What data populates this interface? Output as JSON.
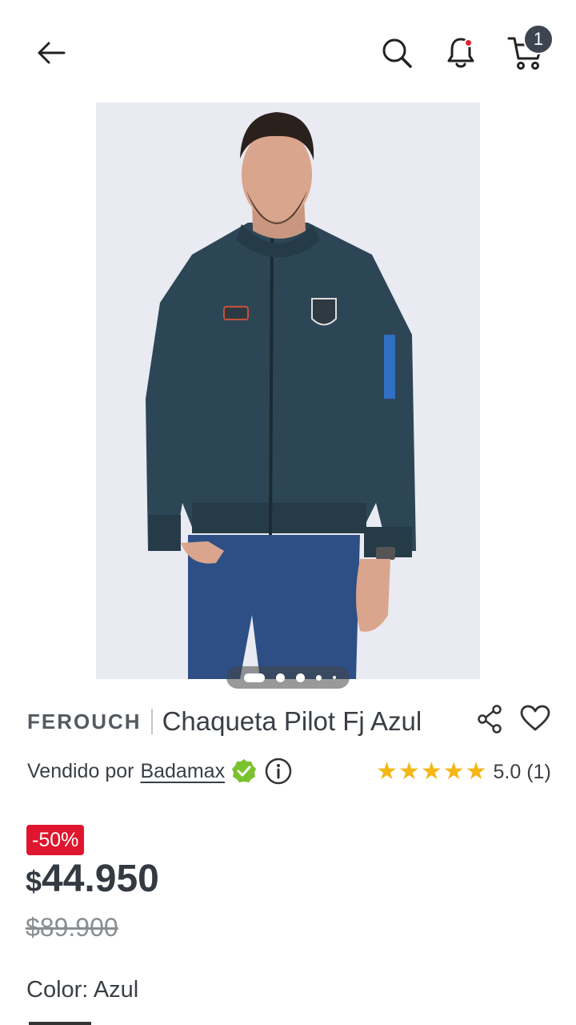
{
  "header": {
    "back_icon": "arrow-left-icon",
    "search_icon": "search-icon",
    "notifications_icon": "bell-icon",
    "cart_icon": "cart-icon",
    "cart_count": "1",
    "notification_dot_color": "#e0242f"
  },
  "gallery": {
    "image_description": "product-photo",
    "dots_total": 5,
    "active_index": 0
  },
  "product": {
    "brand": "FEROUCH",
    "title": "Chaqueta Pilot Fj Azul",
    "sold_by_label": "Vendido por",
    "seller": "Badamax",
    "rating": "5.0 (1)",
    "stars": 5,
    "discount": "-50%",
    "price_currency": "$",
    "price": "44.950",
    "old_price": "$89.900",
    "color_label": "Color: Azul"
  },
  "colors": {
    "accent_red": "#e0152f",
    "star_gold": "#f6b614",
    "verified_green": "#7ac22e",
    "badge_gray": "#3d4650"
  }
}
